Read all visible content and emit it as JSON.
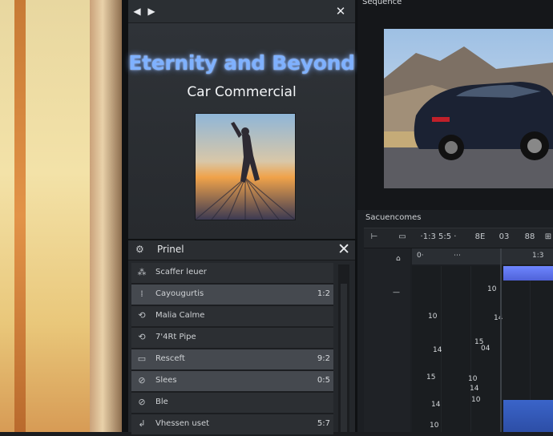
{
  "preview": {
    "title": "Eternity and Beyond",
    "subtitle": "Car Commercial",
    "play_icon": "◀",
    "forward_icon": "▶",
    "close_icon": "✕"
  },
  "monitor": {
    "label": "Sequence"
  },
  "layers": {
    "title": "Prinel",
    "close_icon": "✕",
    "rows": [
      {
        "icon": "⁂",
        "label": "Scaffer leuer",
        "value": ""
      },
      {
        "icon": "⁞",
        "label": "Cayougurtis",
        "value": "1:2"
      },
      {
        "icon": "⟲",
        "label": "Malia Calme",
        "value": ""
      },
      {
        "icon": "⟲",
        "label": "7'4Rt Pipe",
        "value": ""
      },
      {
        "icon": "▭",
        "label": "Resceft",
        "value": "9:2"
      },
      {
        "icon": "⊘",
        "label": "Slees",
        "value": "0:5"
      },
      {
        "icon": "⊘",
        "label": "Ble",
        "value": ""
      },
      {
        "icon": "↲",
        "label": "Vhessen uset",
        "value": "5:7"
      }
    ]
  },
  "timeline": {
    "label": "Sacuencomes",
    "tools": [
      "⊢",
      "▭",
      "·1:3 5:5 ·",
      "8E",
      "03",
      "88",
      "⊞"
    ],
    "ruler_marks": [
      "0·",
      "⋯",
      "1:3"
    ],
    "left_numbers": [
      "10",
      "14",
      "15",
      "04",
      "10",
      "14",
      "10"
    ],
    "track_numbers": [
      "10",
      "14",
      "15",
      "14",
      "10"
    ]
  },
  "colors": {
    "title_glow": "#7fb1ff",
    "clip_blue": "#6e86ff"
  }
}
